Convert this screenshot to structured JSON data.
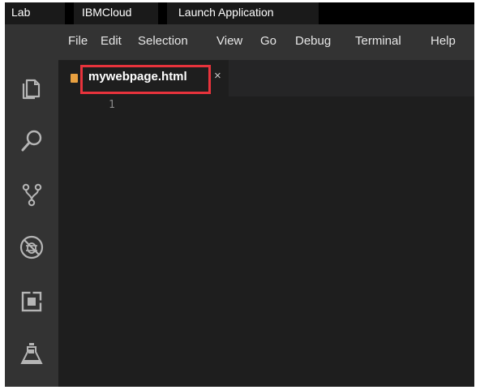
{
  "lab_tabs": [
    {
      "label": "Lab"
    },
    {
      "label": "IBMCloud"
    },
    {
      "label": "Launch Application"
    }
  ],
  "menu": {
    "items": [
      {
        "label": "File"
      },
      {
        "label": "Edit"
      },
      {
        "label": "Selection"
      },
      {
        "label": "View"
      },
      {
        "label": "Go"
      },
      {
        "label": "Debug"
      },
      {
        "label": "Terminal"
      },
      {
        "label": "Help"
      }
    ]
  },
  "activity_bar": {
    "icons": [
      "files-icon",
      "search-icon",
      "source-control-icon",
      "debug-icon",
      "extensions-icon",
      "lab-flask-icon"
    ]
  },
  "editor": {
    "tab": {
      "filename": "mywebpage.html",
      "close_glyph": "×"
    },
    "line_numbers": [
      "1"
    ]
  },
  "colors": {
    "highlight": "#e8333c",
    "file_icon": "#e8a040",
    "editor_bg": "#1e1e1e",
    "sidebar_bg": "#333333"
  }
}
